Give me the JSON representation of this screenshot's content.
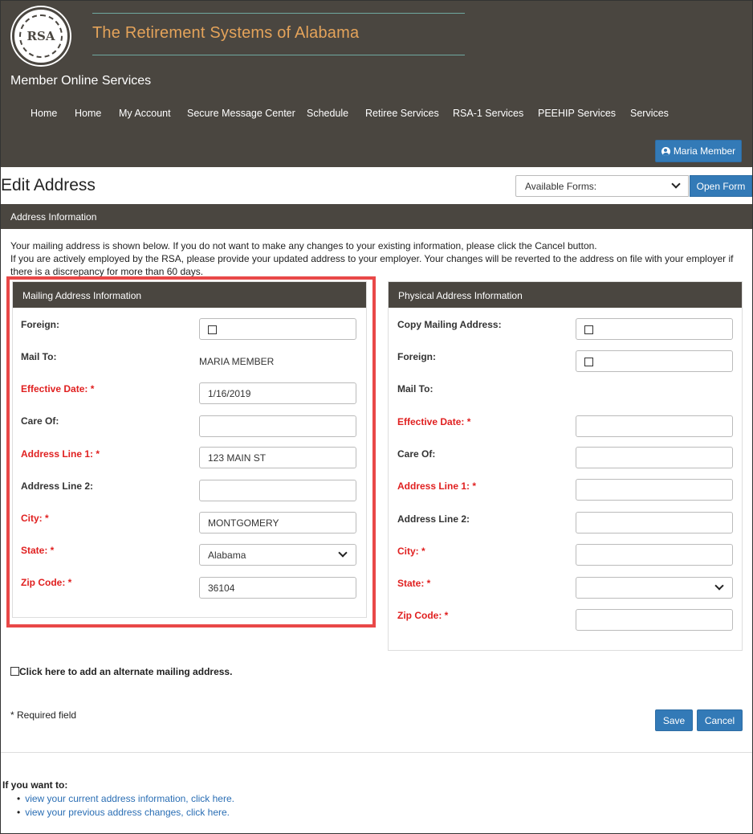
{
  "brand": {
    "logo_text": "RSA",
    "title": "The Retirement Systems of Alabama",
    "subtitle": "Member Online Services"
  },
  "nav": [
    "Home",
    "Home",
    "My Account",
    "Secure Message Center",
    "Schedule",
    "Retiree Services",
    "RSA-1 Services",
    "PEEHIP Services",
    "Services"
  ],
  "user": {
    "name": "Maria Member",
    "icon": "user-circle-icon"
  },
  "page": {
    "title": "Edit Address",
    "forms_select": "Available Forms:",
    "open_form_label": "Open Form"
  },
  "section": {
    "title": "Address Information"
  },
  "intro": {
    "line1": "Your mailing address is shown below. If you do not want to make any changes to your existing information, please click the Cancel button.",
    "line2": "If you are actively employed by the RSA, please provide your updated address to your employer. Your changes will be reverted to the address on file with your employer if there is a discrepancy for more than 60 days."
  },
  "mailing": {
    "title": "Mailing Address Information",
    "labels": {
      "foreign": "Foreign:",
      "mail_to": "Mail To:",
      "effective_date": "Effective Date: *",
      "care_of": "Care Of:",
      "address1": "Address Line 1: *",
      "address2": "Address Line 2:",
      "city": "City: *",
      "state": "State: *",
      "zip": "Zip Code: *"
    },
    "values": {
      "foreign_checked": false,
      "mail_to": "MARIA MEMBER",
      "effective_date": "1/16/2019",
      "care_of": "",
      "address1": "123 MAIN ST",
      "address2": "",
      "city": "MONTGOMERY",
      "state": "Alabama",
      "zip": "36104"
    }
  },
  "physical": {
    "title": "Physical Address Information",
    "labels": {
      "copy": "Copy Mailing Address:",
      "foreign": "Foreign:",
      "mail_to": "Mail To:",
      "effective_date": "Effective Date: *",
      "care_of": "Care Of:",
      "address1": "Address Line 1: *",
      "address2": "Address Line 2:",
      "city": "City: *",
      "state": "State: *",
      "zip": "Zip Code: *"
    },
    "values": {
      "copy_checked": false,
      "foreign_checked": false,
      "effective_date": "",
      "care_of": "",
      "address1": "",
      "address2": "",
      "city": "",
      "state": "",
      "zip": ""
    }
  },
  "alternate": {
    "label": "Click here to add an alternate mailing address."
  },
  "required_note": "* Required field",
  "actions": {
    "save": "Save",
    "cancel": "Cancel"
  },
  "footer": {
    "heading": "If you want to:",
    "links": [
      "view your current address information, click here.",
      "view your previous address changes, click here."
    ]
  },
  "colors": {
    "header_bg": "#4a4640",
    "brand_title": "#e4a35a",
    "accent_blue": "#337ab7",
    "required_red": "#e02020",
    "highlight": "#e94848"
  }
}
